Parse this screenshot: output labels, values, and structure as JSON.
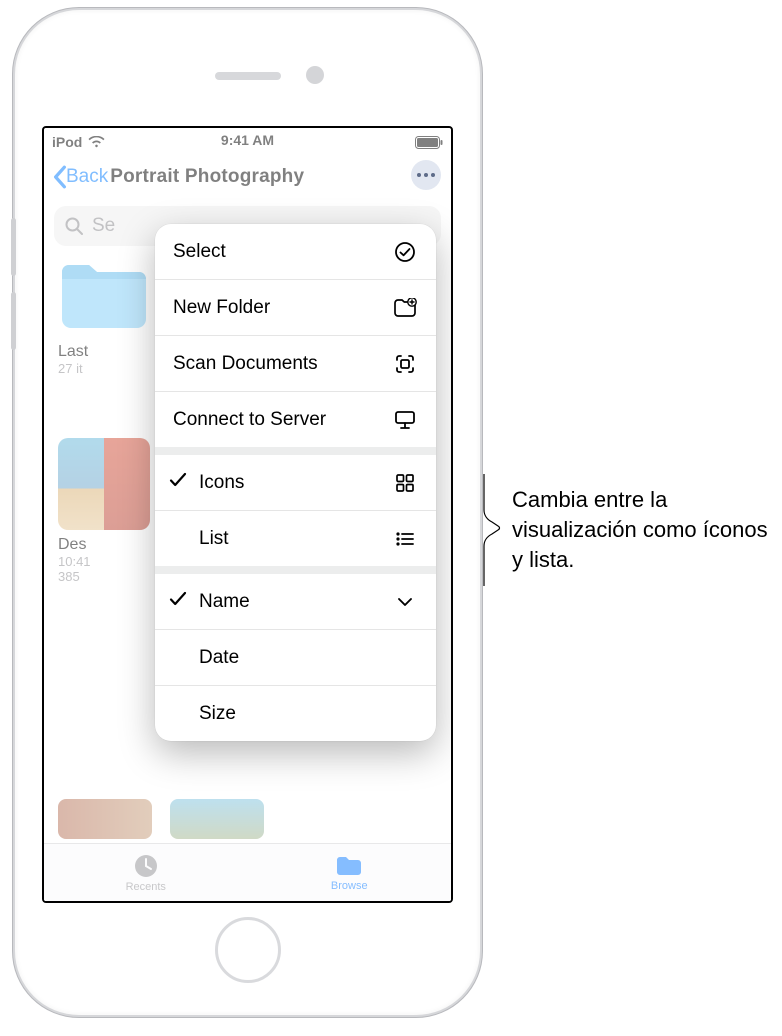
{
  "status": {
    "carrier": "iPod",
    "time": "9:41 AM"
  },
  "nav": {
    "back": "Back",
    "title": "Portrait Photography"
  },
  "search": {
    "placeholder": "Search",
    "truncated": "Se"
  },
  "gridItems": {
    "folder": {
      "name_truncated": "Last",
      "sub_truncated": "27 it"
    },
    "thumb": {
      "name_truncated": "Des",
      "meta1": "10:41",
      "meta2": "385"
    }
  },
  "menu": {
    "actions": [
      {
        "key": "select",
        "label": "Select"
      },
      {
        "key": "newfolder",
        "label": "New Folder"
      },
      {
        "key": "scan",
        "label": "Scan Documents"
      },
      {
        "key": "server",
        "label": "Connect to Server"
      }
    ],
    "view": [
      {
        "key": "icons",
        "label": "Icons",
        "checked": true
      },
      {
        "key": "list",
        "label": "List",
        "checked": false
      }
    ],
    "sort": [
      {
        "key": "name",
        "label": "Name",
        "checked": true
      },
      {
        "key": "date",
        "label": "Date",
        "checked": false
      },
      {
        "key": "size",
        "label": "Size",
        "checked": false
      }
    ]
  },
  "tabs": {
    "recents": "Recents",
    "browse": "Browse"
  },
  "callout": "Cambia entre la visualización como íconos y lista."
}
